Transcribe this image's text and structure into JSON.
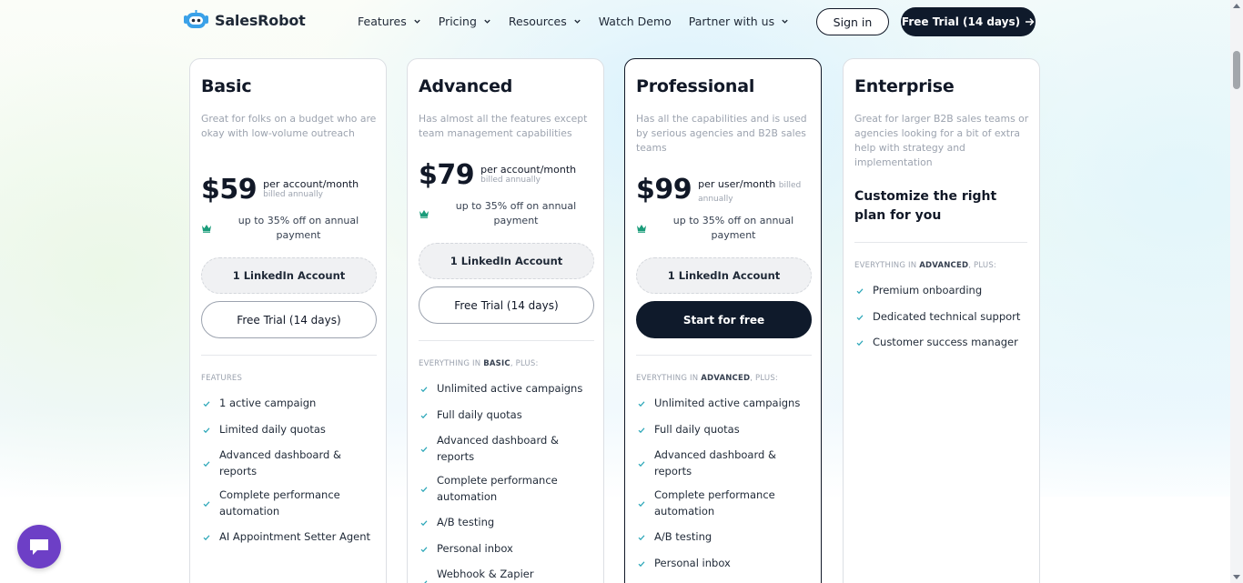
{
  "header": {
    "logo_text": "SalesRobot",
    "nav": [
      "Features",
      "Pricing",
      "Resources",
      "Watch Demo",
      "Partner with us"
    ],
    "sign_in": "Sign in",
    "free_trial": "Free Trial (14 days)"
  },
  "plans": [
    {
      "name": "Basic",
      "description": "Great for folks on a budget who are okay with low-volume outreach",
      "price": "$59",
      "unit": "per account/month",
      "billing": "billed annually",
      "discount": "up to 35% off on annual payment",
      "accounts": "1 LinkedIn Account",
      "cta": "Free Trial (14 days)",
      "features_head": "FEATURES",
      "features": [
        "1 active campaign",
        "Limited daily quotas",
        "Advanced dashboard & reports",
        "Complete performance automation",
        "AI Appointment Setter Agent"
      ]
    },
    {
      "name": "Advanced",
      "description": "Has almost all the features except team management capabilities",
      "price": "$79",
      "unit": "per account/month",
      "billing": "billed annually",
      "discount": "up to 35% off on annual payment",
      "accounts": "1 LinkedIn Account",
      "cta": "Free Trial (14 days)",
      "features_head_pre": "EVERYTHING IN ",
      "features_head_bold": "BASIC",
      "features_head_post": ", PLUS:",
      "features": [
        "Unlimited active campaigns",
        "Full daily quotas",
        "Advanced dashboard & reports",
        "Complete performance automation",
        "A/B testing",
        "Personal inbox",
        "Webhook & Zapier integration"
      ]
    },
    {
      "name": "Professional",
      "description": "Has all the capabilities and is used by serious agencies and B2B sales teams",
      "price": "$99",
      "unit": "per user/month",
      "billing": "billed annually",
      "discount": "up to 35% off on annual payment",
      "accounts": "1 LinkedIn Account",
      "cta": "Start for free",
      "features_head_pre": "EVERYTHING IN ",
      "features_head_bold": "ADVANCED",
      "features_head_post": ", PLUS:",
      "features": [
        "Unlimited active campaigns",
        "Full daily quotas",
        "Advanced dashboard & reports",
        "Complete performance automation",
        "A/B testing",
        "Personal inbox"
      ]
    },
    {
      "name": "Enterprise",
      "description": "Great for larger B2B sales teams or agencies looking for a bit of extra help with strategy and implementation",
      "subheading": "Customize the right plan for you",
      "features_head_pre": "EVERYTHING IN ",
      "features_head_bold": "ADVANCED",
      "features_head_post": ", PLUS:",
      "features": [
        "Premium onboarding",
        "Dedicated technical support",
        "Customer success manager"
      ]
    }
  ],
  "colors": {
    "accent_dark": "#0f1a2b",
    "crown": "#1a9c7a",
    "check": "#2aa6b8",
    "chat": "#6d3fc6"
  },
  "icons": {
    "chat": "chat-bubble-icon",
    "crown": "crown-icon",
    "check": "check-icon"
  }
}
